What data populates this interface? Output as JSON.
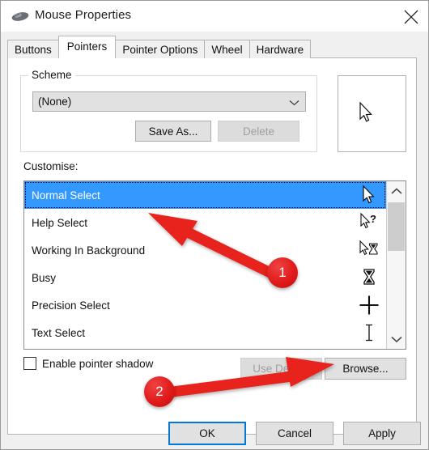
{
  "window": {
    "title": "Mouse Properties",
    "icon": "mouse-icon",
    "close_label": "×"
  },
  "tabs": [
    {
      "label": "Buttons",
      "active": false
    },
    {
      "label": "Pointers",
      "active": true
    },
    {
      "label": "Pointer Options",
      "active": false
    },
    {
      "label": "Wheel",
      "active": false
    },
    {
      "label": "Hardware",
      "active": false
    }
  ],
  "scheme": {
    "group_label": "Scheme",
    "combo_value": "(None)",
    "combo_icon": "chevron-down-icon",
    "save_as_label": "Save As...",
    "delete_label": "Delete",
    "delete_disabled": true
  },
  "customise": {
    "label": "Customise:",
    "items": [
      {
        "label": "Normal Select",
        "cursor": "arrow-cursor-icon",
        "selected": true
      },
      {
        "label": "Help Select",
        "cursor": "arrow-question-cursor-icon",
        "selected": false
      },
      {
        "label": "Working In Background",
        "cursor": "arrow-hourglass-cursor-icon",
        "selected": false
      },
      {
        "label": "Busy",
        "cursor": "hourglass-cursor-icon",
        "selected": false
      },
      {
        "label": "Precision Select",
        "cursor": "crosshair-cursor-icon",
        "selected": false
      },
      {
        "label": "Text Select",
        "cursor": "ibeam-cursor-icon",
        "selected": false
      }
    ],
    "scroll_up_icon": "chevron-up-icon",
    "scroll_down_icon": "chevron-down-icon"
  },
  "options": {
    "enable_shadow_label": "Enable pointer shadow",
    "enable_shadow_checked": false,
    "use_default_label": "Use Default",
    "use_default_disabled": true,
    "browse_label": "Browse..."
  },
  "preview": {
    "cursor": "arrow-cursor-icon"
  },
  "footer": {
    "ok_label": "OK",
    "cancel_label": "Cancel",
    "apply_label": "Apply"
  },
  "annotations": {
    "badge_1": "1",
    "badge_2": "2",
    "color": "#e01b1b"
  }
}
